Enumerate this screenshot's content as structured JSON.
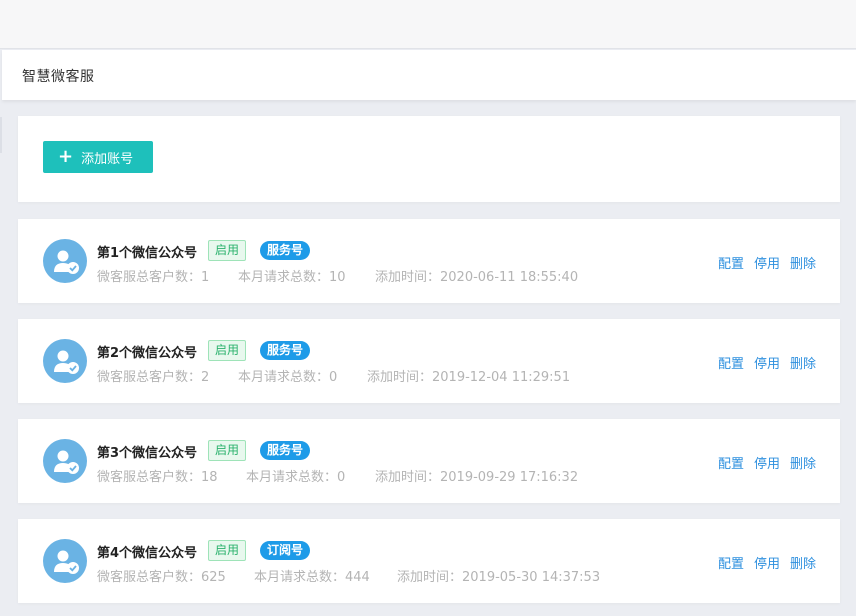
{
  "header": {
    "title": "智慧微客服"
  },
  "toolbar": {
    "add_label": "添加账号"
  },
  "accounts": [
    {
      "name": "第1个微信公众号",
      "status": "启用",
      "type": "服务号",
      "customers_label": "微客服总客户数：",
      "customers": "1",
      "requests_label": "本月请求总数：",
      "requests": "10",
      "added_label": "添加时间：",
      "added": "2020-06-11 18:55:40"
    },
    {
      "name": "第2个微信公众号",
      "status": "启用",
      "type": "服务号",
      "customers_label": "微客服总客户数：",
      "customers": "2",
      "requests_label": "本月请求总数：",
      "requests": "0",
      "added_label": "添加时间：",
      "added": "2019-12-04 11:29:51"
    },
    {
      "name": "第3个微信公众号",
      "status": "启用",
      "type": "服务号",
      "customers_label": "微客服总客户数：",
      "customers": "18",
      "requests_label": "本月请求总数：",
      "requests": "0",
      "added_label": "添加时间：",
      "added": "2019-09-29 17:16:32"
    },
    {
      "name": "第4个微信公众号",
      "status": "启用",
      "type": "订阅号",
      "customers_label": "微客服总客户数：",
      "customers": "625",
      "requests_label": "本月请求总数：",
      "requests": "444",
      "added_label": "添加时间：",
      "added": "2019-05-30 14:37:53"
    }
  ],
  "actions": {
    "config": "配置",
    "disable": "停用",
    "delete": "删除"
  }
}
